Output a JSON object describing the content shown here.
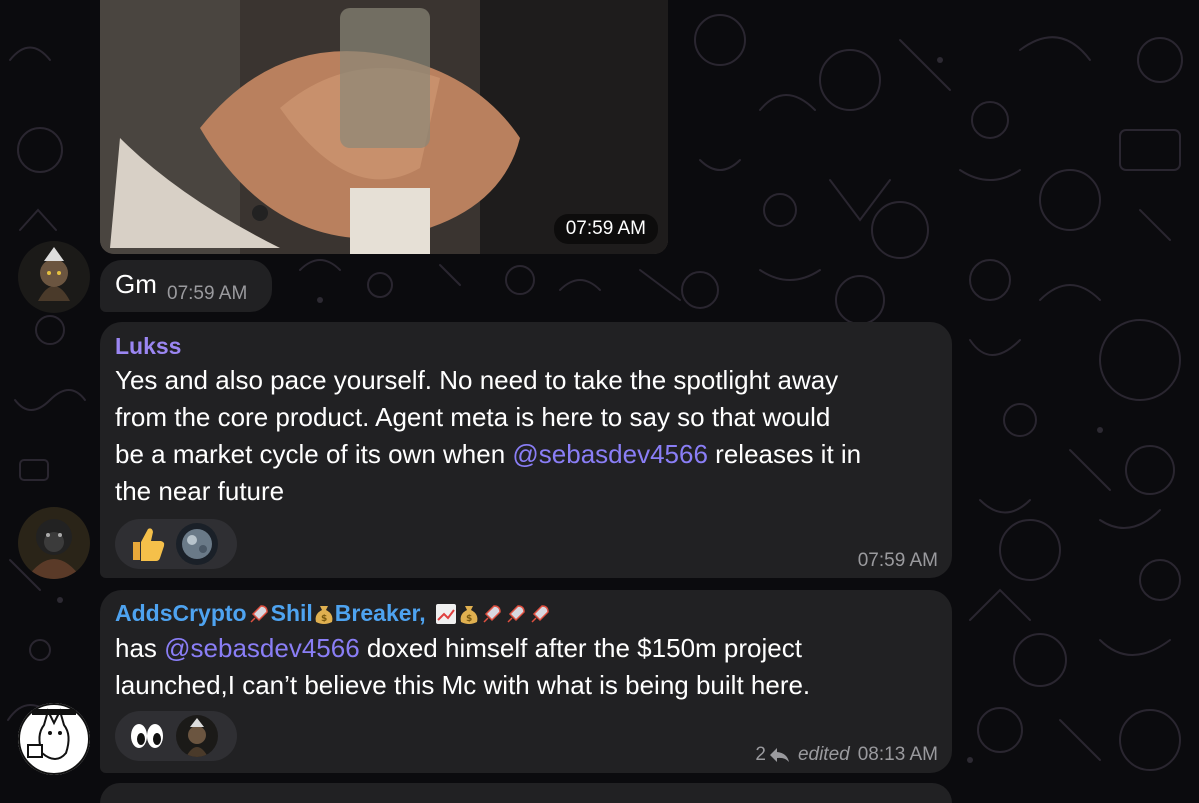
{
  "colors": {
    "background": "#0b0b0e",
    "bubble": "#212123",
    "sender_lukss": "#9b86f2",
    "sender_adds": "#4ea3f0",
    "mention": "#8a7ef6",
    "meta": "#9a9a9e"
  },
  "messages": [
    {
      "type": "media",
      "time": "07:59 AM"
    },
    {
      "type": "text",
      "text": "Gm",
      "time": "07:59 AM"
    },
    {
      "type": "text",
      "sender": "Lukss",
      "lines": [
        "Yes and also pace yourself. No need to take the spotlight away",
        "from the core product. Agent meta is here to say so that would",
        "be a market cycle of its own when ",
        "@sebasdev4566",
        " releases it in",
        "the near future"
      ],
      "reactions": [
        "thumbs-up",
        "planet-avatar"
      ],
      "time": "07:59 AM"
    },
    {
      "type": "text",
      "sender_parts": [
        "AddsCrypto",
        "rocket",
        " Shil",
        "money-bag",
        "Breaker, ",
        "chart-up",
        "money-bag",
        "rocket",
        "rocket",
        "rocket"
      ],
      "sender_text_a": "AddsCrypto",
      "sender_text_b": " Shil",
      "sender_text_c": "Breaker,",
      "lines": [
        "has ",
        "@sebasdev4566",
        " doxed himself after the $150m project",
        "launched,I can’t believe this Mc with what is being built here."
      ],
      "reactions": [
        "eyes",
        "goblin-avatar"
      ],
      "reply_count": "2",
      "edited_label": "edited",
      "time": "08:13 AM"
    }
  ]
}
